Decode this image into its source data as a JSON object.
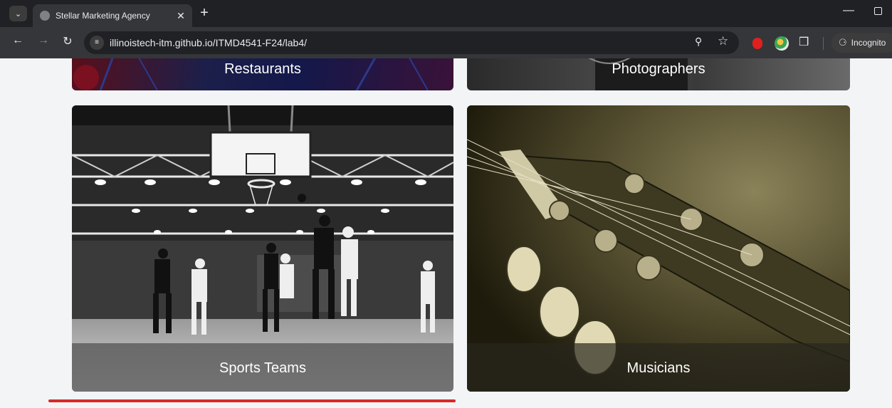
{
  "browser": {
    "tab_title": "Stellar Marketing Agency",
    "new_tab_label": "+",
    "url": "illinoistech-itm.github.io/ITMD4541-F24/lab4/",
    "profile_label": "Incognito"
  },
  "cards": {
    "restaurants": "Restaurants",
    "photographers": "Photographers",
    "sports_teams": "Sports Teams",
    "musicians": "Musicians"
  },
  "colors": {
    "accent_underline": "#d62828",
    "page_background": "#f2f4f6"
  },
  "icons": [
    "tab-search-icon",
    "globe-icon",
    "close-icon",
    "back-arrow-icon",
    "forward-arrow-icon",
    "reload-icon",
    "site-info-icon",
    "zoom-icon",
    "star-icon",
    "extension-icon",
    "puzzle-icon",
    "incognito-icon",
    "minimize-icon",
    "restore-icon"
  ]
}
